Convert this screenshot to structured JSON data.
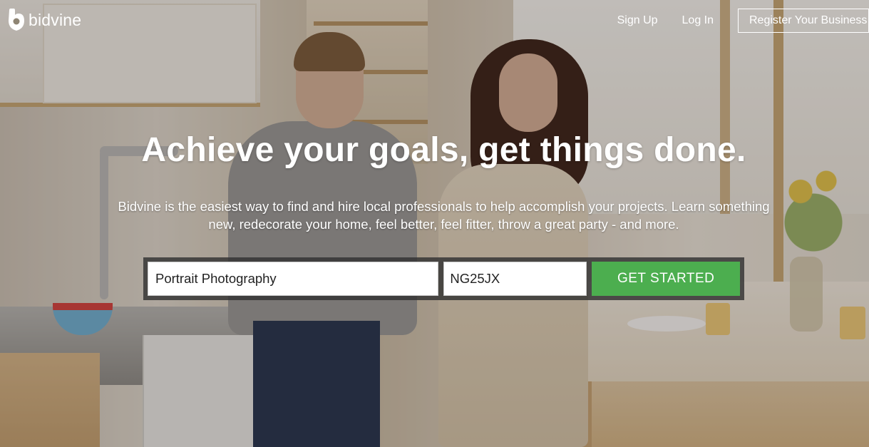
{
  "brand": {
    "name": "bidvine",
    "logo_icon": "bidvine-logo-icon",
    "accent_color": "#4cae4f"
  },
  "nav": {
    "sign_up": "Sign Up",
    "log_in": "Log In",
    "register": "Register Your Business"
  },
  "hero": {
    "headline": "Achieve your goals, get things done.",
    "subtext": "Bidvine is the easiest way to find and hire local professionals to help accomplish your projects. Learn something new, redecorate your home, feel better, feel fitter, throw a great party - and more."
  },
  "search": {
    "service_value": "Portrait Photography",
    "postcode_value": "NG25JX",
    "submit_label": "GET STARTED"
  }
}
